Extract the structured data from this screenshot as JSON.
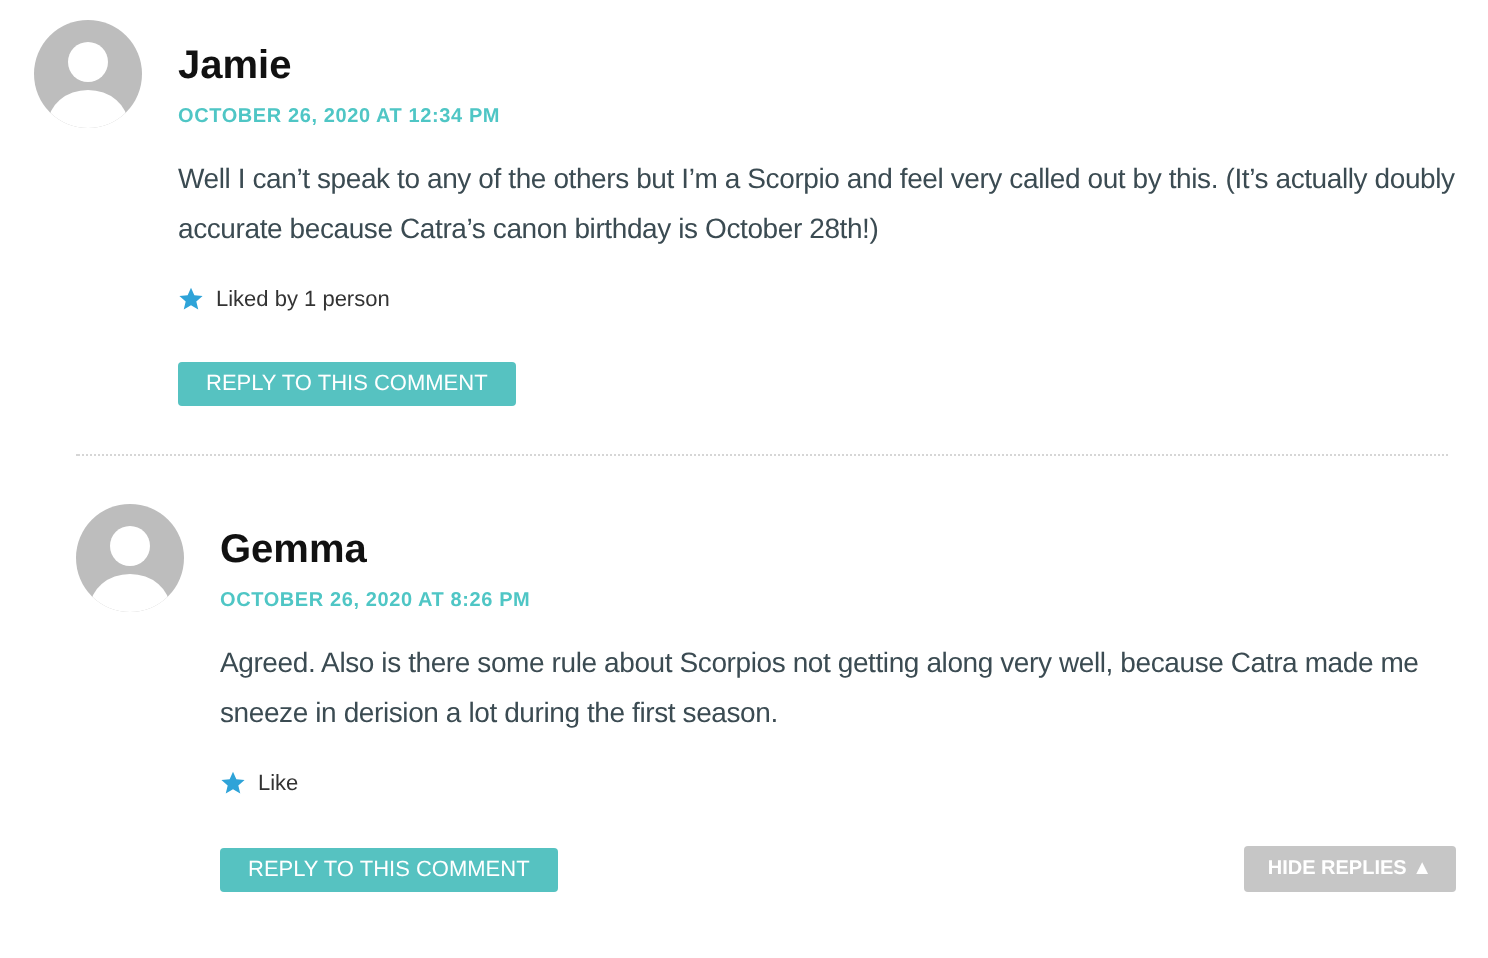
{
  "comments": [
    {
      "author": "Jamie",
      "date": "OCTOBER 26, 2020 AT 12:34 PM",
      "body": "Well I can’t speak to any of the others but I’m a Scorpio and feel very called out by this. (It’s actually doubly accurate because Catra’s canon birthday is October 28th!)",
      "likes": "Liked by 1 person",
      "reply": "REPLY TO THIS COMMENT",
      "children": [
        {
          "author": "Gemma",
          "date": "OCTOBER 26, 2020 AT 8:26 PM",
          "body": "Agreed. Also is there some rule about Scorpios not getting along very well, because Catra made me sneeze in derision a lot during the first season.",
          "likes": "Like",
          "reply": "REPLY TO THIS COMMENT",
          "toggle": "HIDE REPLIES ▲"
        }
      ]
    }
  ]
}
